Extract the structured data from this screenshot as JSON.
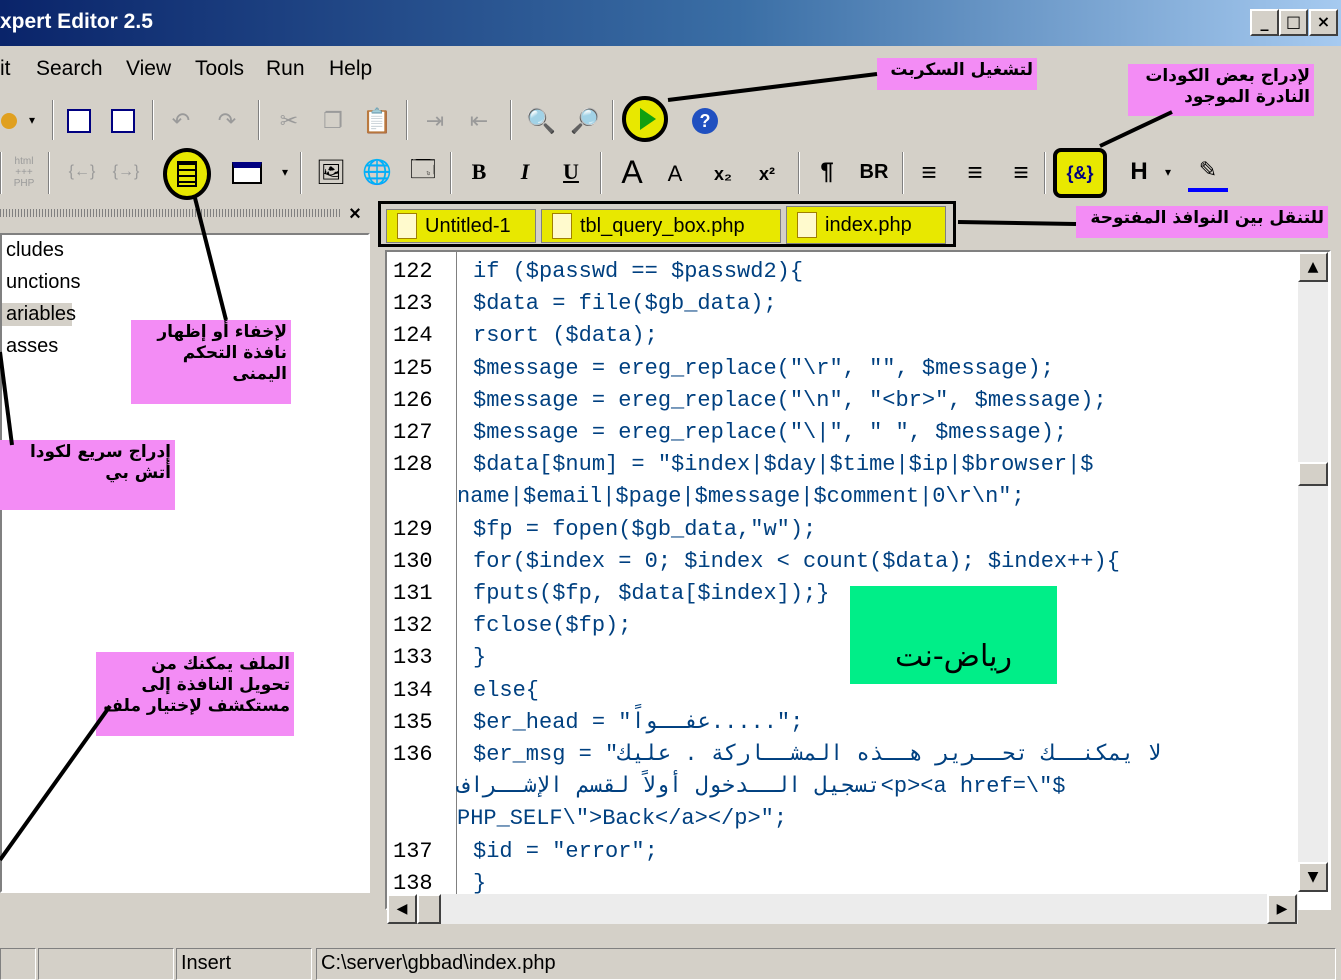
{
  "window": {
    "title": "xpert Editor 2.5",
    "min": "_",
    "max": "□",
    "close": "×"
  },
  "menu": [
    "it",
    "Search",
    "View",
    "Tools",
    "Run",
    "Help"
  ],
  "toolbar2": {
    "bold": "B",
    "italic": "I",
    "underline": "U",
    "font_up": "A",
    "font_down": "A",
    "sub": "x₂",
    "sup": "x²",
    "para": "¶",
    "br": "BR",
    "special": "{&}",
    "heading": "H",
    "html_label": "html +++ PHP"
  },
  "tabs": [
    "Untitled-1",
    "tbl_query_box.php",
    "index.php"
  ],
  "panel": {
    "close": "×",
    "items": [
      "cludes",
      "unctions",
      "ariables",
      "asses"
    ]
  },
  "annotations": {
    "run": "لتشغيل السكربت",
    "rare_codes": "لإدراج بعض الكودات النادرة الموجود",
    "tabs_nav": "للتنقل بين النوافذ المفتوحة",
    "toggle_panel": "لإخفاء أو إظهار نافذة التحكم اليمنى",
    "quick_insert": "إدراج سريع لكودا أتش بي",
    "file_explorer": "الملف يمكنك من تحويل النافذة إلى مستكشف لإختيار ملف"
  },
  "watermark": "رياض-نت",
  "code_lines": [
    {
      "n": "122",
      "code": "if ($passwd == $passwd2){"
    },
    {
      "n": "123",
      "code": "$data = file($gb_data);"
    },
    {
      "n": "124",
      "code": "rsort ($data);"
    },
    {
      "n": "125",
      "code": "$message = ereg_replace(\"\\r\", \"\", $message);"
    },
    {
      "n": "126",
      "code": "$message = ereg_replace(\"\\n\", \"<br>\", $message);"
    },
    {
      "n": "127",
      "code": "$message = ereg_replace(\"\\|\", \" \", $message);"
    },
    {
      "n": "128",
      "code": "$data[$num] = \"$index|$day|$time|$ip|$browser|$"
    },
    {
      "n": "",
      "code": "name|$email|$page|$message|$comment|0\\r\\n\";"
    },
    {
      "n": "129",
      "code": "$fp = fopen($gb_data,\"w\");"
    },
    {
      "n": "130",
      "code": "for($index = 0; $index < count($data); $index++){"
    },
    {
      "n": "131",
      "code": "fputs($fp, $data[$index]);}"
    },
    {
      "n": "132",
      "code": "fclose($fp);"
    },
    {
      "n": "133",
      "code": "}"
    },
    {
      "n": "134",
      "code": "else{"
    },
    {
      "n": "135",
      "code": "$er_head = \"عفــواً.....\";"
    },
    {
      "n": "136",
      "code": "$er_msg = \"لا يمكنــك تحــرير هــذه المشــاركة . عليك"
    },
    {
      "n": "",
      "code": "تسجيل الــدخول أولاً لقسم الإشــراف<p><a href=\\\"$"
    },
    {
      "n": "",
      "code": "PHP_SELF\\\">Back</a></p>\";"
    },
    {
      "n": "137",
      "code": "$id = \"error\";"
    },
    {
      "n": "138",
      "code": "}"
    }
  ],
  "status": {
    "mode": "Insert",
    "path": "C:\\server\\gbbad\\index.php"
  }
}
